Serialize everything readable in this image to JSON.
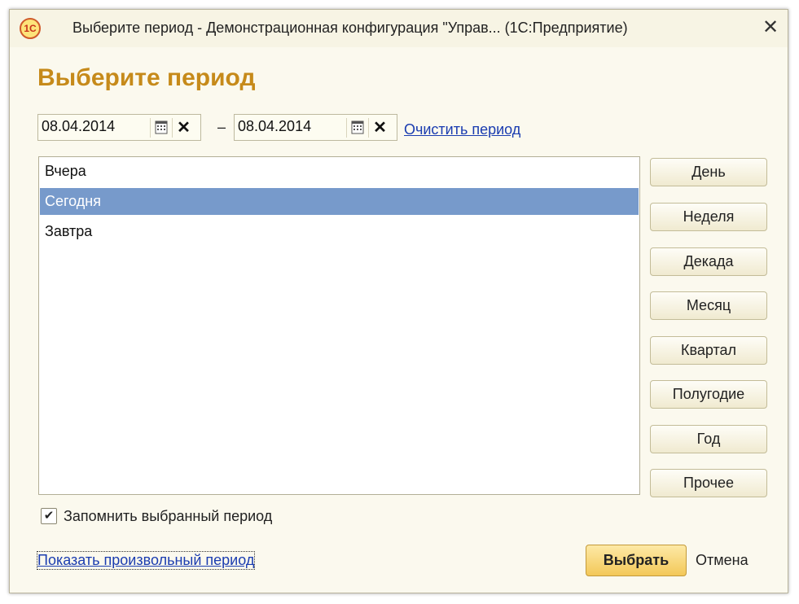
{
  "window": {
    "title": "Выберите период - Демонстрационная конфигурация \"Управ... (1С:Предприятие)",
    "app_icon": "1С",
    "close_glyph": "✕"
  },
  "form": {
    "title": "Выберите период",
    "date_from": "08.04.2014",
    "date_to": "08.04.2014",
    "dash": "–",
    "clear_glyph": "✕",
    "clear_period_label": "Очистить период"
  },
  "list": {
    "items": [
      {
        "label": "Вчера",
        "selected": false
      },
      {
        "label": "Сегодня",
        "selected": true
      },
      {
        "label": "Завтра",
        "selected": false
      }
    ]
  },
  "period_buttons": [
    "День",
    "Неделя",
    "Декада",
    "Месяц",
    "Квартал",
    "Полугодие",
    "Год",
    "Прочее"
  ],
  "remember": {
    "label": "Запомнить выбранный период",
    "checked": true,
    "check_glyph": "✔"
  },
  "footer": {
    "show_arbitrary_label": "Показать произвольный период",
    "ok_label": "Выбрать",
    "cancel_label": "Отмена"
  },
  "colors": {
    "accent_title": "#c68a1a",
    "selection": "#779acb",
    "link": "#1a3cb0",
    "default_button": "#f3c858"
  }
}
